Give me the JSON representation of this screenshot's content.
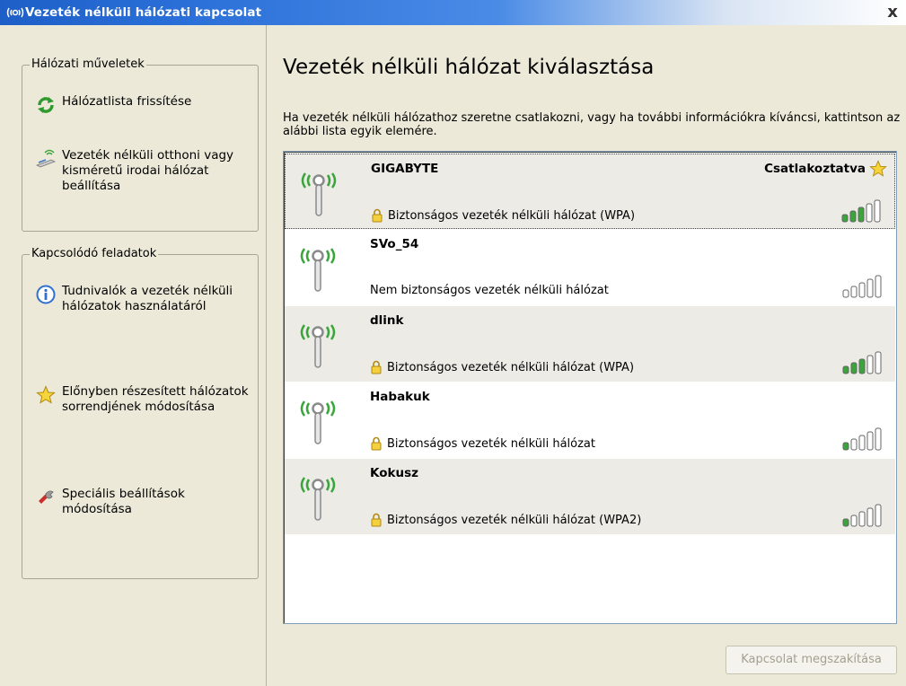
{
  "window": {
    "title": "Vezeték nélküli hálózati kapcsolat",
    "close_label": "x"
  },
  "sidebar": {
    "network_tasks": {
      "title": "Hálózati műveletek",
      "items": [
        {
          "label": "Hálózatlista frissítése",
          "icon": "refresh-icon"
        },
        {
          "label": "Vezeték nélküli otthoni vagy kisméretű irodai hálózat beállítása",
          "icon": "wireless-setup-icon"
        }
      ]
    },
    "related_tasks": {
      "title": "Kapcsolódó feladatok",
      "items": [
        {
          "label": "Tudnivalók a vezeték nélküli hálózatok használatáról",
          "icon": "info-icon"
        },
        {
          "label": "Előnyben részesített hálózatok sorrendjének módosítása",
          "icon": "star-icon"
        },
        {
          "label": "Speciális beállítások módosítása",
          "icon": "advanced-settings-icon"
        }
      ]
    }
  },
  "main": {
    "heading": "Vezeték nélküli hálózat kiválasztása",
    "intro": "Ha vezeték nélküli hálózathoz szeretne csatlakozni, vagy ha további információkra kíváncsi, kattintson az alábbi lista egyik elemére.",
    "networks": [
      {
        "ssid": "GIGABYTE",
        "security": "Biztonságos vezeték nélküli hálózat (WPA)",
        "secured": true,
        "status": "Csatlakoztatva",
        "signal_bars": 3
      },
      {
        "ssid": "SVo_54",
        "security": "Nem biztonságos vezeték nélküli hálózat",
        "secured": false,
        "status": "",
        "signal_bars": 0
      },
      {
        "ssid": "dlink",
        "security": "Biztonságos vezeték nélküli hálózat (WPA)",
        "secured": true,
        "status": "",
        "signal_bars": 3
      },
      {
        "ssid": "Habakuk",
        "security": "Biztonságos vezeték nélküli hálózat",
        "secured": true,
        "status": "",
        "signal_bars": 1
      },
      {
        "ssid": "Kokusz",
        "security": "Biztonságos vezeték nélküli hálózat (WPA2)",
        "secured": true,
        "status": "",
        "signal_bars": 1
      }
    ],
    "disconnect_label": "Kapcsolat megszakítása"
  },
  "colors": {
    "signal_on": "#3aa53a",
    "signal_off": "#ffffff",
    "title_bar": "#2a6fd8"
  }
}
